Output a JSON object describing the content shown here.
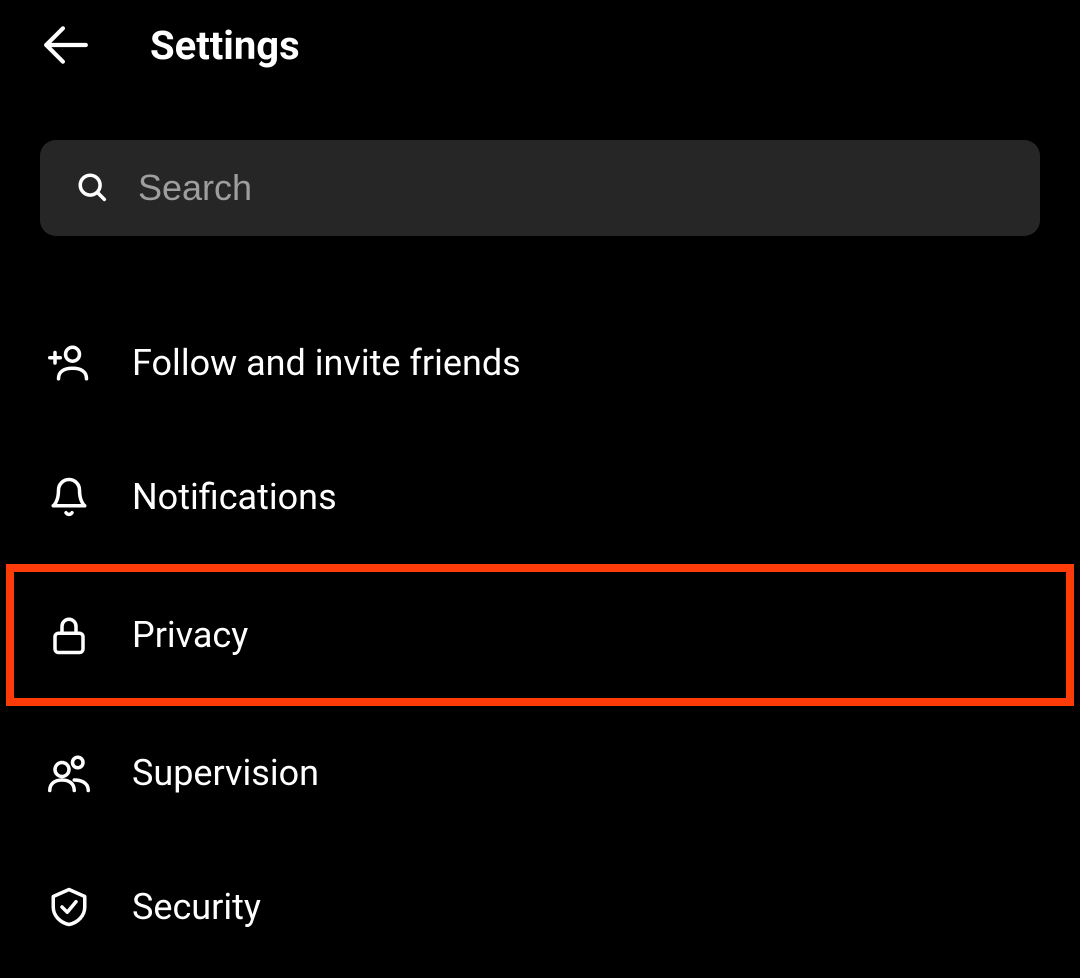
{
  "header": {
    "title": "Settings"
  },
  "search": {
    "placeholder": "Search"
  },
  "menu": {
    "items": [
      {
        "label": "Follow and invite friends",
        "icon": "add-person-icon",
        "highlighted": false
      },
      {
        "label": "Notifications",
        "icon": "bell-icon",
        "highlighted": false
      },
      {
        "label": "Privacy",
        "icon": "lock-icon",
        "highlighted": true
      },
      {
        "label": "Supervision",
        "icon": "people-icon",
        "highlighted": false
      },
      {
        "label": "Security",
        "icon": "shield-check-icon",
        "highlighted": false
      }
    ]
  }
}
